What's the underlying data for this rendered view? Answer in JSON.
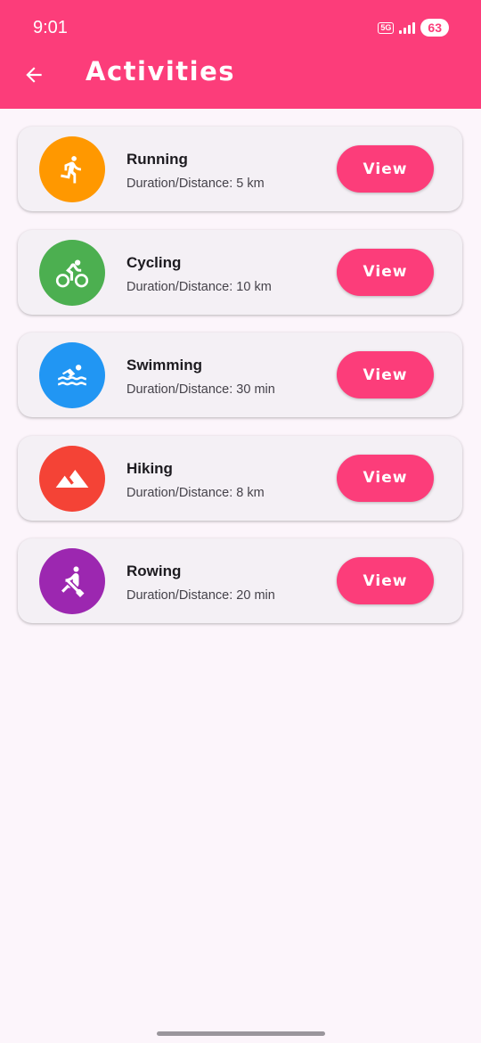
{
  "status_bar": {
    "time": "9:01",
    "network": "5G",
    "battery": "63"
  },
  "header": {
    "title": "Activities",
    "back_icon": "arrow-left-icon"
  },
  "colors": {
    "primary": "#fc3d7a",
    "background": "#fcf5fb",
    "card": "#f4f0f5"
  },
  "activities": [
    {
      "name": "Running",
      "detail": "Duration/Distance: 5 km",
      "icon": "running-icon",
      "color": "#ff9800",
      "button": "View"
    },
    {
      "name": "Cycling",
      "detail": "Duration/Distance: 10 km",
      "icon": "cycling-icon",
      "color": "#4caf50",
      "button": "View"
    },
    {
      "name": "Swimming",
      "detail": "Duration/Distance: 30 min",
      "icon": "swimming-icon",
      "color": "#2196f3",
      "button": "View"
    },
    {
      "name": "Hiking",
      "detail": "Duration/Distance: 8 km",
      "icon": "hiking-icon",
      "color": "#f44336",
      "button": "View"
    },
    {
      "name": "Rowing",
      "detail": "Duration/Distance: 20 min",
      "icon": "rowing-icon",
      "color": "#9c27b0",
      "button": "View"
    }
  ]
}
